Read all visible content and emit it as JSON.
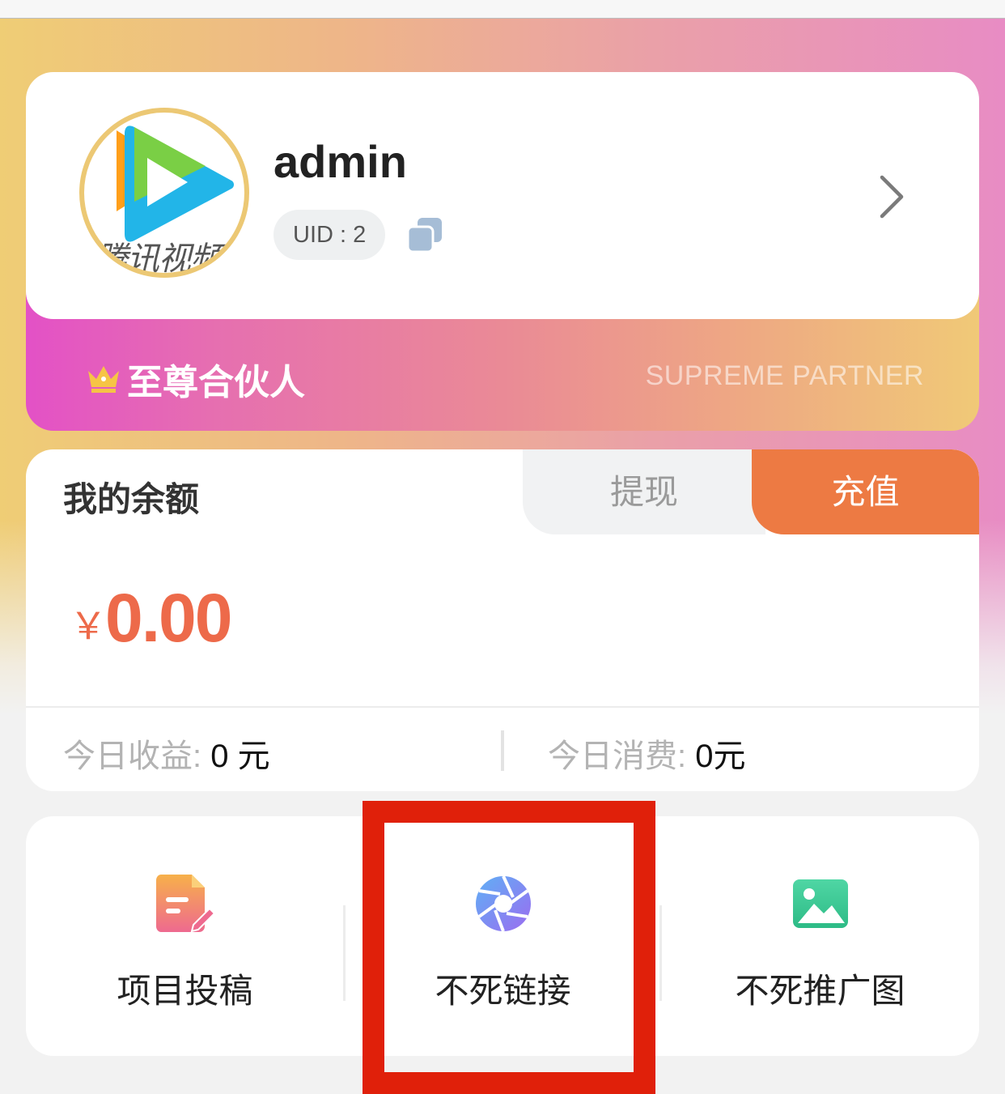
{
  "profile": {
    "username": "admin",
    "uid_label": "UID : 2",
    "avatar_text": "腾讯视频",
    "icons": {
      "copy": "copy-icon",
      "chevron": "chevron-right-icon"
    }
  },
  "vip": {
    "title": "至尊合伙人",
    "subtitle_en": "SUPREME PARTNER",
    "icon": "crown-icon"
  },
  "balance": {
    "title": "我的余额",
    "withdraw_label": "提现",
    "recharge_label": "充值",
    "currency_symbol": "￥",
    "amount": "0.00",
    "today_income_label": "今日收益:",
    "today_income_value": " 0 元",
    "today_spend_label": "今日消费:",
    "today_spend_value": " 0元"
  },
  "menu": {
    "items": [
      {
        "label": "项目投稿",
        "icon": "document-edit-icon"
      },
      {
        "label": "不死链接",
        "icon": "aperture-icon"
      },
      {
        "label": "不死推广图",
        "icon": "image-icon"
      }
    ]
  },
  "colors": {
    "accent_orange": "#ed7a43",
    "amount_red": "#ed6a4a",
    "highlight_red": "#e0200a",
    "avatar_ring": "#ecc874"
  }
}
